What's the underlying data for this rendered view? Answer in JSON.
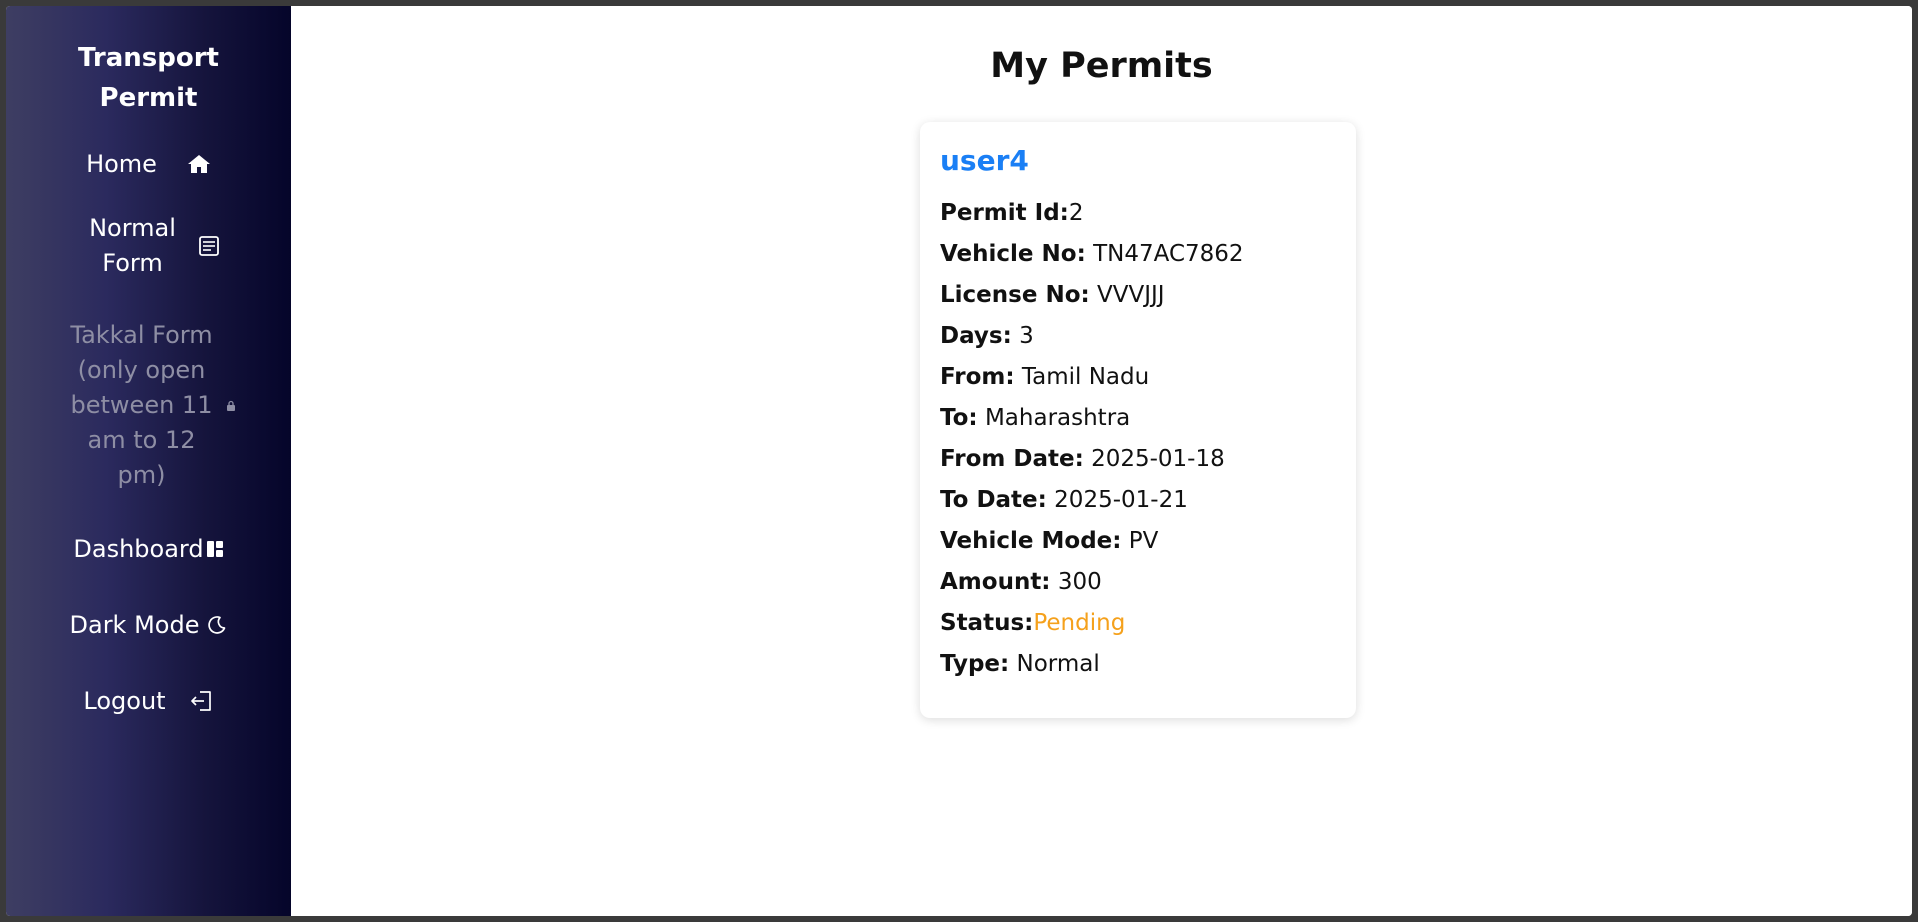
{
  "sidebar": {
    "brand": "Transport Permit",
    "items": [
      {
        "label": "Home",
        "icon": "home-icon"
      },
      {
        "label": "Normal Form",
        "icon": "form-icon"
      },
      {
        "label": "Takkal Form (only open between 11 am to 12 pm)",
        "icon": "lock-icon",
        "disabled": true
      },
      {
        "label": "Dashboard",
        "icon": "dashboard-icon"
      },
      {
        "label": "Dark Mode",
        "icon": "moon-icon"
      },
      {
        "label": "Logout",
        "icon": "logout-icon"
      }
    ]
  },
  "main": {
    "title": "My Permits",
    "card": {
      "user": "user4",
      "fields": [
        {
          "label": "Permit Id:",
          "value": "2"
        },
        {
          "label": "Vehicle No:",
          "value": "TN47AC7862"
        },
        {
          "label": "License No:",
          "value": "VVVJJJ"
        },
        {
          "label": "Days:",
          "value": "3"
        },
        {
          "label": "From:",
          "value": "Tamil Nadu"
        },
        {
          "label": "To:",
          "value": "Maharashtra"
        },
        {
          "label": "From Date:",
          "value": "2025-01-18"
        },
        {
          "label": "To Date:",
          "value": "2025-01-21"
        },
        {
          "label": "Vehicle Mode:",
          "value": "PV"
        },
        {
          "label": "Amount:",
          "value": "300"
        },
        {
          "label": "Status:",
          "value": "Pending"
        },
        {
          "label": "Type:",
          "value": "Normal"
        }
      ]
    }
  },
  "colors": {
    "user_name": "#1a7ff5",
    "status_pending": "#f5a11c",
    "sidebar_dark": "#05052a",
    "sidebar_light": "#3e3e62",
    "disabled_text": "#8e8ea4"
  }
}
